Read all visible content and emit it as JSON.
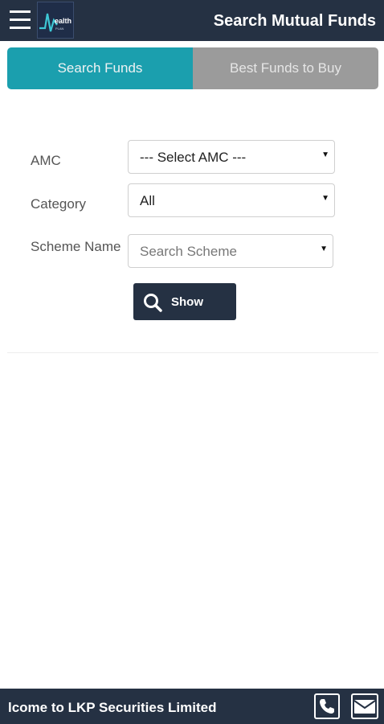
{
  "header": {
    "title": "Search Mutual Funds",
    "logo_text": "Wealth",
    "logo_subtext": "PLAN"
  },
  "tabs": [
    {
      "label": "Search Funds",
      "active": true
    },
    {
      "label": "Best Funds to Buy",
      "active": false
    }
  ],
  "form": {
    "amc_label": "AMC",
    "amc_value": "--- Select AMC ---",
    "category_label": "Category",
    "category_value": "All",
    "scheme_label": "Scheme Name",
    "scheme_placeholder": "Search Scheme",
    "show_button": "Show"
  },
  "footer": {
    "marquee": "lcome to LKP Securities Limited"
  },
  "colors": {
    "header_bg": "#253143",
    "tab_active": "#1b9fae",
    "tab_inactive": "#9b9b9b"
  }
}
